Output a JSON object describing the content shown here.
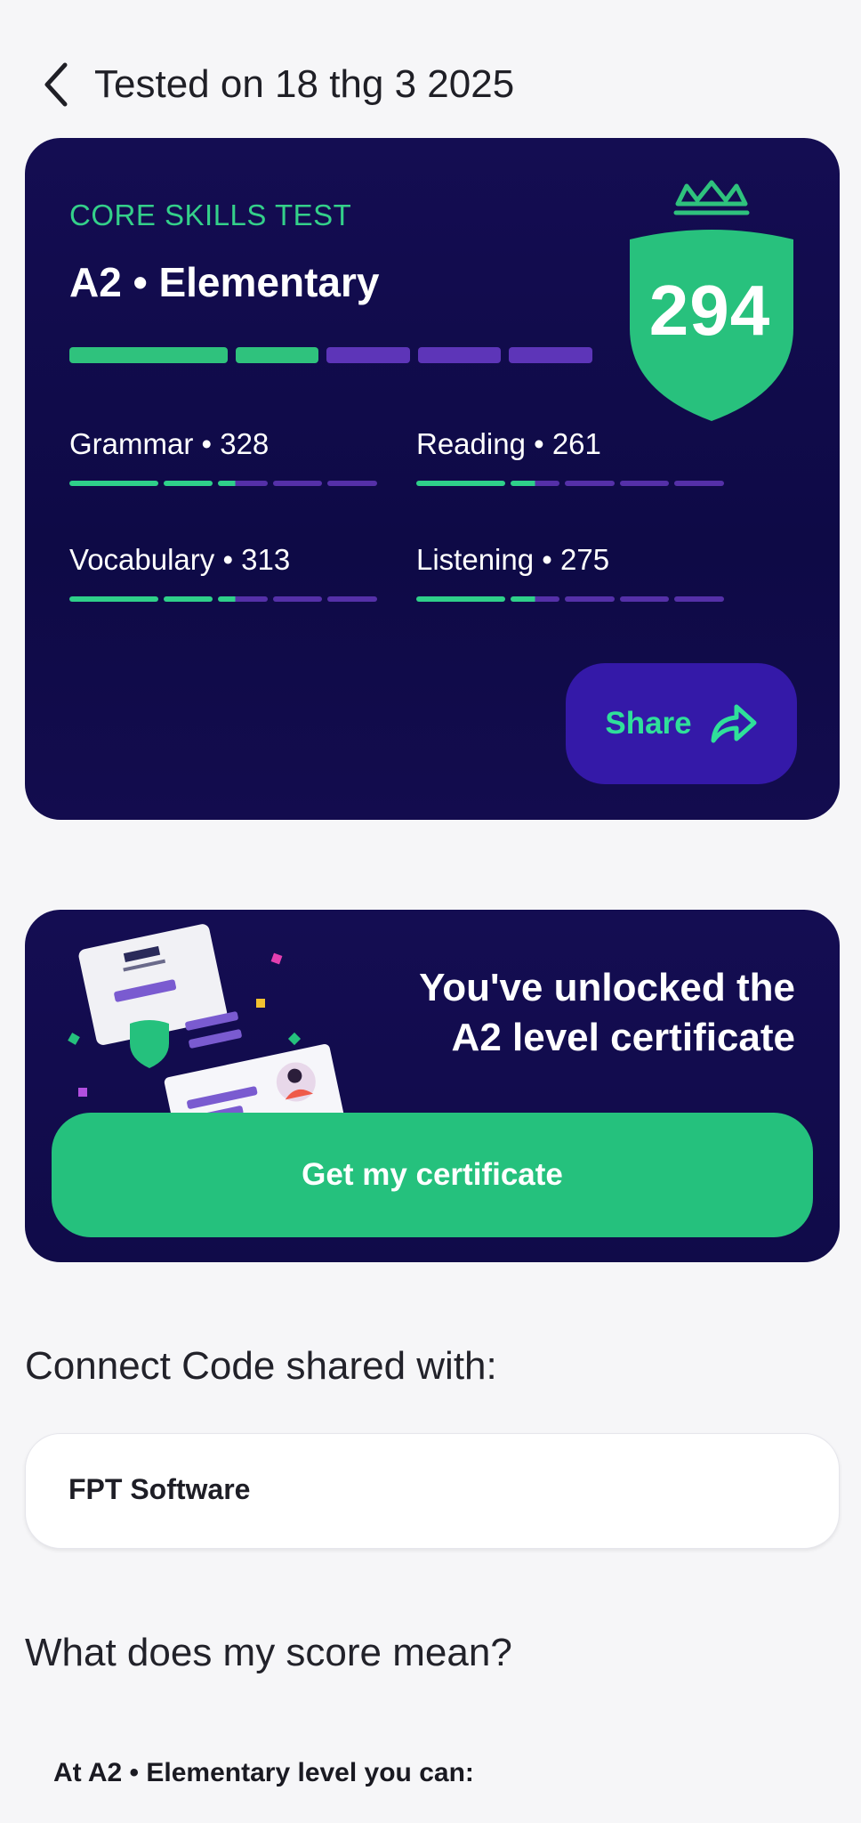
{
  "header": {
    "back_icon": "chevron-left-icon",
    "title": "Tested on 18 thg 3 2025"
  },
  "score_card": {
    "test_name": "CORE SKILLS TEST",
    "level": "A2 • Elementary",
    "overall_score": "294",
    "overall_progress_segments_filled": 2,
    "overall_progress_segments_total": 6,
    "skills": [
      {
        "label": "Grammar • 328"
      },
      {
        "label": "Reading • 261"
      },
      {
        "label": "Vocabulary • 313"
      },
      {
        "label": "Listening • 275"
      }
    ],
    "share_label": "Share",
    "share_icon": "share-arrow-icon"
  },
  "certificate": {
    "title_line1": "You've unlocked the",
    "title_line2": "A2 level certificate",
    "button_label": "Get my certificate"
  },
  "connect_code": {
    "heading": "Connect Code shared with:",
    "shared_with": "FPT Software"
  },
  "score_meaning": {
    "heading": "What does my score mean?",
    "line": "At A2 • Elementary level you can:"
  },
  "colors": {
    "card_bg": "#140d52",
    "accent_green": "#2fc27d",
    "accent_purple": "#5d35b8",
    "share_bg": "#3419a8"
  }
}
